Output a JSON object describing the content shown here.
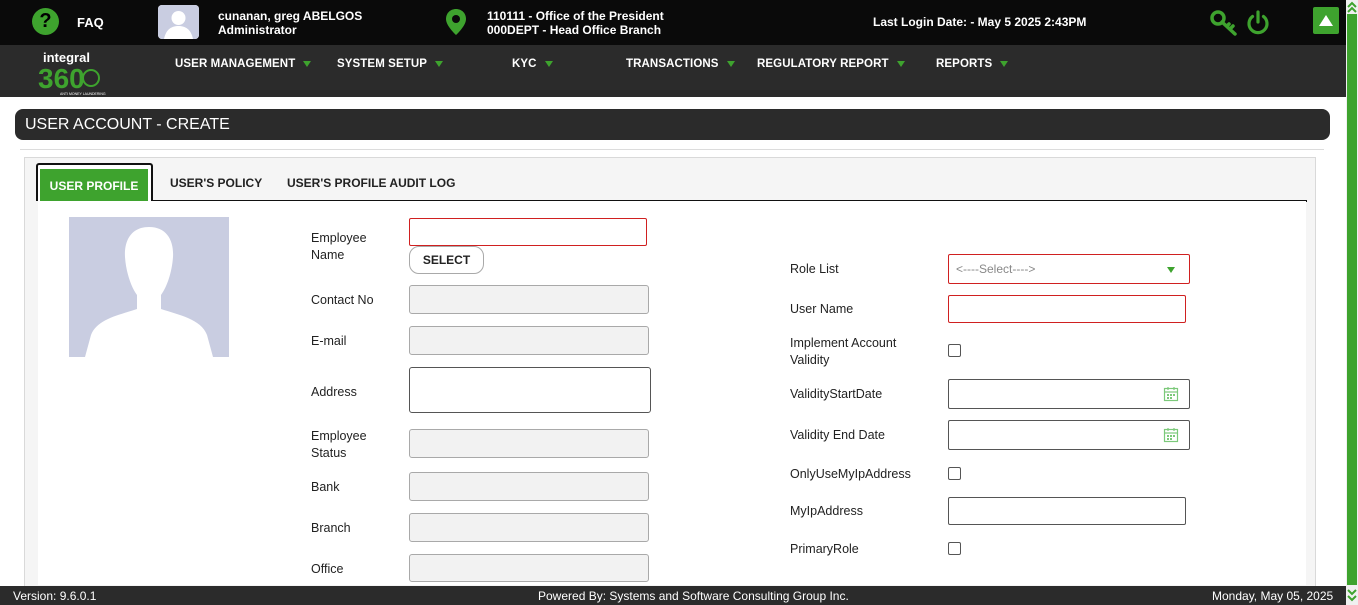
{
  "topbar": {
    "faq": "FAQ",
    "user_name": "cunanan, greg ABELGOS",
    "user_role": "Administrator",
    "office_line1": "110111 - Office of the President",
    "office_line2": "000DEPT - Head Office Branch",
    "last_login": "Last Login Date: - May 5 2025 2:43PM",
    "icons": [
      "help-icon",
      "avatar",
      "location-pin-icon",
      "key-icon",
      "power-icon",
      "arrow-up-icon"
    ]
  },
  "brand": {
    "logo_text": "integral",
    "logo_number": "360",
    "logo_tagline": "ANTI MONEY LAUNDERING"
  },
  "nav": {
    "items": [
      {
        "label": "USER MANAGEMENT"
      },
      {
        "label": "SYSTEM SETUP"
      },
      {
        "label": "KYC"
      },
      {
        "label": "TRANSACTIONS"
      },
      {
        "label": "REGULATORY REPORT"
      },
      {
        "label": "REPORTS"
      }
    ]
  },
  "page": {
    "title": "USER ACCOUNT - CREATE"
  },
  "tabs": [
    {
      "label": "USER PROFILE",
      "active": true
    },
    {
      "label": "USER'S POLICY",
      "active": false
    },
    {
      "label": "USER'S PROFILE AUDIT LOG",
      "active": false
    }
  ],
  "form": {
    "left": {
      "employee_name": "Employee Name",
      "select_button": "SELECT",
      "contact_no": "Contact No",
      "email": "E-mail",
      "address": "Address",
      "employee_status": "Employee Status",
      "bank": "Bank",
      "branch": "Branch",
      "office": "Office"
    },
    "right": {
      "role_list": "Role List",
      "role_placeholder": "<----Select---->",
      "user_name": "User Name",
      "implement_validity": "Implement Account Validity",
      "validity_start": "ValidityStartDate",
      "validity_end": "Validity End Date",
      "only_use_ip": "OnlyUseMyIpAddress",
      "my_ip": "MyIpAddress",
      "primary_role": "PrimaryRole"
    }
  },
  "footer": {
    "version": "Version: 9.6.0.1",
    "powered_by": "Powered By: Systems and Software Consulting Group Inc.",
    "date": "Monday, May 05, 2025"
  },
  "colors": {
    "accent": "#3ea32e",
    "dark": "#2b2b2b",
    "required": "#d02020"
  }
}
